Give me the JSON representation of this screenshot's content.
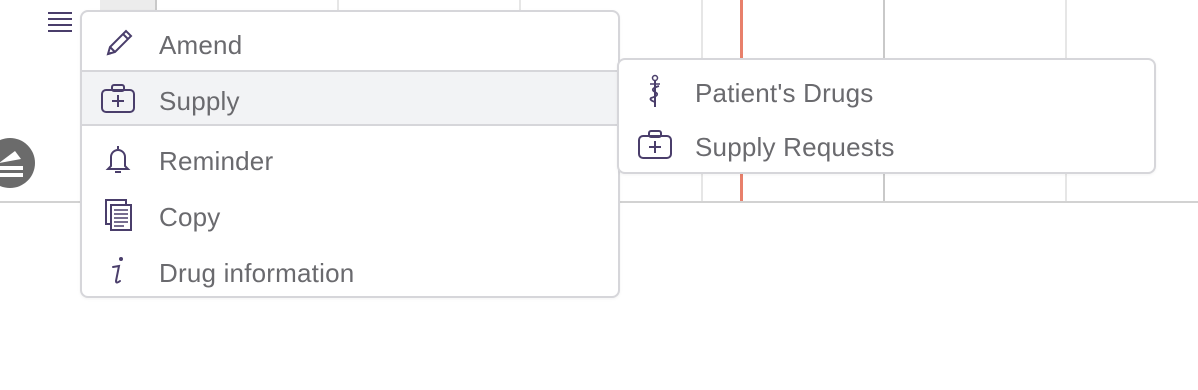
{
  "context_menu": {
    "items": [
      {
        "label": "Amend",
        "icon": "pencil-icon"
      },
      {
        "label": "Supply",
        "icon": "medical-bag-icon",
        "active": true
      },
      {
        "label": "Reminder",
        "icon": "bell-icon"
      },
      {
        "label": "Copy",
        "icon": "copy-icon"
      },
      {
        "label": "Drug information",
        "icon": "info-icon"
      }
    ]
  },
  "submenu": {
    "parent": "Supply",
    "items": [
      {
        "label": "Patient's Drugs",
        "icon": "caduceus-icon"
      },
      {
        "label": "Supply Requests",
        "icon": "medical-bag-icon"
      }
    ]
  },
  "colors": {
    "icon": "#4a3e6b",
    "text": "#6a6a6e",
    "active_row": "#f2f3f5",
    "border": "#d6d6da",
    "current_time_line": "#e8806b"
  }
}
